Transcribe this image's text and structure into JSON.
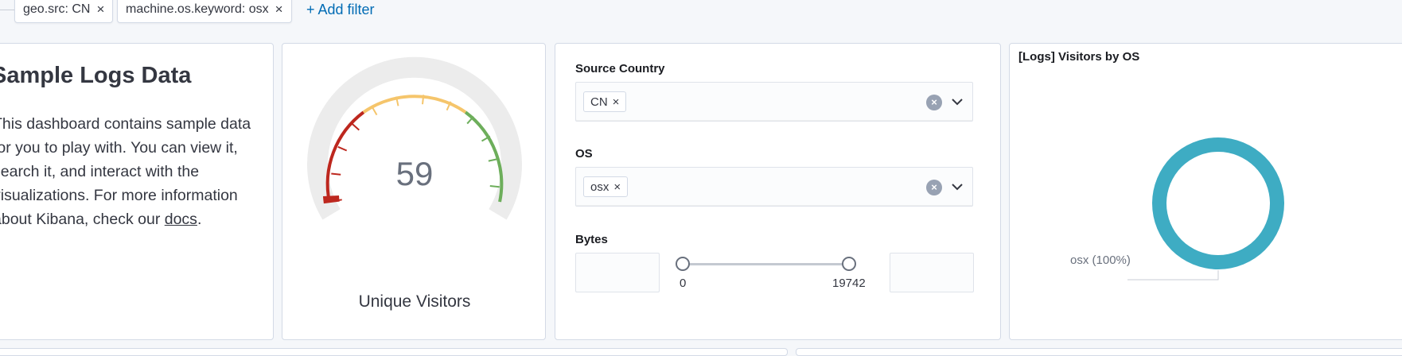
{
  "filters": [
    {
      "label": "geo.src: CN",
      "remove_icon": "×"
    },
    {
      "label": "machine.os.keyword: osx",
      "remove_icon": "×"
    }
  ],
  "add_filter_label": "+ Add filter",
  "markdown_panel": {
    "title": "Sample Logs Data",
    "body_before_link": "This dashboard contains sample data for you to play with. You can view it, search it, and interact with the visualizations. For more information about Kibana, check our ",
    "link_text": "docs",
    "body_after_link": "."
  },
  "gauge_panel": {
    "value": "59",
    "label": "Unique Visitors",
    "colors": {
      "red": "#bd271e",
      "yellow": "#f5c56b",
      "green": "#6dae5b",
      "background": "#ececec"
    }
  },
  "controls_panel": {
    "source_country": {
      "label": "Source Country",
      "selected": "CN"
    },
    "os": {
      "label": "OS",
      "selected": "osx"
    },
    "bytes": {
      "label": "Bytes",
      "min": "0",
      "max": "19742"
    }
  },
  "visitors_panel": {
    "title": "[Logs] Visitors by OS",
    "slice_label": "osx (100%)",
    "color": "#3eacc3"
  }
}
